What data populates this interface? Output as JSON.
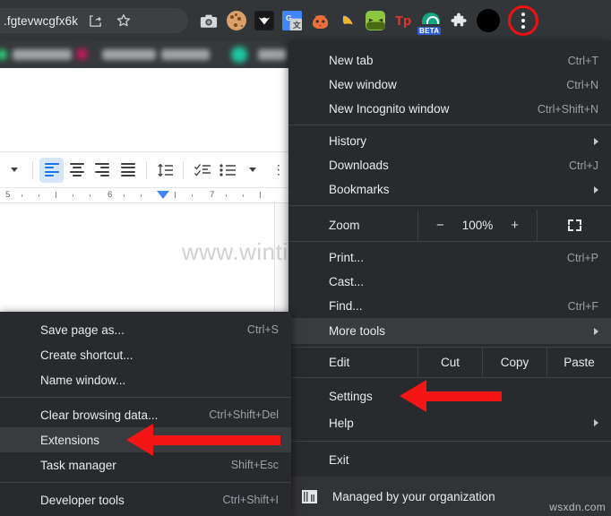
{
  "browser": {
    "omnibox": {
      "url_text": ".fgtevwcgfx6k",
      "share_icon": "share-icon",
      "bookmark_star_icon": "star-icon"
    },
    "extensions": [
      {
        "name": "screenshot-extension-icon",
        "glyph": "■"
      },
      {
        "name": "cookie-extension-icon",
        "glyph": ""
      },
      {
        "name": "owl-extension-icon",
        "glyph": "▼"
      },
      {
        "name": "google-translate-extension-icon",
        "glyph": "G"
      },
      {
        "name": "firefox-send-extension-icon",
        "glyph": "🦊"
      },
      {
        "name": "honey-extension-icon",
        "glyph": "❧"
      },
      {
        "name": "green-extension-icon",
        "glyph": "••"
      },
      {
        "name": "toolsplus-extension-icon",
        "glyph": "Tp"
      },
      {
        "name": "beta-extension-icon",
        "glyph": "BETA"
      },
      {
        "name": "extensions-puzzle-icon",
        "glyph": "❖"
      }
    ],
    "beta_badge": "BETA",
    "profile_avatar": "avatar",
    "kebab_menu": "three-dot-menu-button"
  },
  "docs": {
    "ruler_numbers": [
      "5",
      "6",
      "7"
    ],
    "toolbar_buttons": [
      "font-size-dropdown",
      "align-left-button",
      "align-center-button",
      "align-right-button",
      "align-justify-button",
      "line-spacing-button",
      "checklist-button",
      "bulleted-list-button",
      "list-options-dropdown",
      "more-options-button"
    ]
  },
  "watermark": {
    "primary": "www.wintips.org",
    "secondary": "wsxdn.com"
  },
  "main_menu": {
    "groups": [
      {
        "items": [
          {
            "label": "New tab",
            "accel": "Ctrl+T",
            "arrow": false,
            "highlighted": false
          },
          {
            "label": "New window",
            "accel": "Ctrl+N",
            "arrow": false,
            "highlighted": false
          },
          {
            "label": "New Incognito window",
            "accel": "Ctrl+Shift+N",
            "arrow": false,
            "highlighted": false
          }
        ]
      },
      {
        "items": [
          {
            "label": "History",
            "accel": "",
            "arrow": true,
            "highlighted": false
          },
          {
            "label": "Downloads",
            "accel": "Ctrl+J",
            "arrow": false,
            "highlighted": false
          },
          {
            "label": "Bookmarks",
            "accel": "",
            "arrow": true,
            "highlighted": false
          }
        ]
      }
    ],
    "zoom": {
      "label": "Zoom",
      "minus": "−",
      "value": "100%",
      "plus": "+",
      "fullscreen_icon": "fullscreen-icon"
    },
    "print_group": [
      {
        "label": "Print...",
        "accel": "Ctrl+P",
        "arrow": false,
        "highlighted": false
      },
      {
        "label": "Cast...",
        "accel": "",
        "arrow": false,
        "highlighted": false
      },
      {
        "label": "Find...",
        "accel": "Ctrl+F",
        "arrow": false,
        "highlighted": false
      },
      {
        "label": "More tools",
        "accel": "",
        "arrow": true,
        "highlighted": true
      }
    ],
    "edit_row": {
      "label": "Edit",
      "actions": [
        "Cut",
        "Copy",
        "Paste"
      ]
    },
    "settings_group": [
      {
        "label": "Settings",
        "accel": "",
        "arrow": false,
        "highlighted": false
      },
      {
        "label": "Help",
        "accel": "",
        "arrow": true,
        "highlighted": false
      }
    ],
    "exit_group": [
      {
        "label": "Exit",
        "accel": "",
        "arrow": false,
        "highlighted": false
      }
    ],
    "managed": {
      "icon": "organization-building-icon",
      "label": "Managed by your organization"
    }
  },
  "sub_menu": {
    "groups": [
      {
        "items": [
          {
            "label": "Save page as...",
            "accel": "Ctrl+S",
            "highlighted": false
          },
          {
            "label": "Create shortcut...",
            "accel": "",
            "highlighted": false
          },
          {
            "label": "Name window...",
            "accel": "",
            "highlighted": false
          }
        ]
      },
      {
        "items": [
          {
            "label": "Clear browsing data...",
            "accel": "Ctrl+Shift+Del",
            "highlighted": false
          },
          {
            "label": "Extensions",
            "accel": "",
            "highlighted": true
          },
          {
            "label": "Task manager",
            "accel": "Shift+Esc",
            "highlighted": false
          }
        ]
      },
      {
        "items": [
          {
            "label": "Developer tools",
            "accel": "Ctrl+Shift+I",
            "highlighted": false
          }
        ]
      }
    ]
  },
  "annotations": [
    {
      "name": "arrow-pointing-to-settings",
      "target": "Settings"
    },
    {
      "name": "arrow-pointing-to-extensions",
      "target": "Extensions"
    },
    {
      "name": "circle-highlight-kebab-menu",
      "target": "three-dot-menu-button"
    }
  ],
  "colors": {
    "menu_bg": "#292a2d",
    "menu_highlight": "#3a3b3e",
    "chrome_bg": "#323639",
    "annotation_red": "#f41515",
    "docs_accent": "#1a73e8"
  }
}
